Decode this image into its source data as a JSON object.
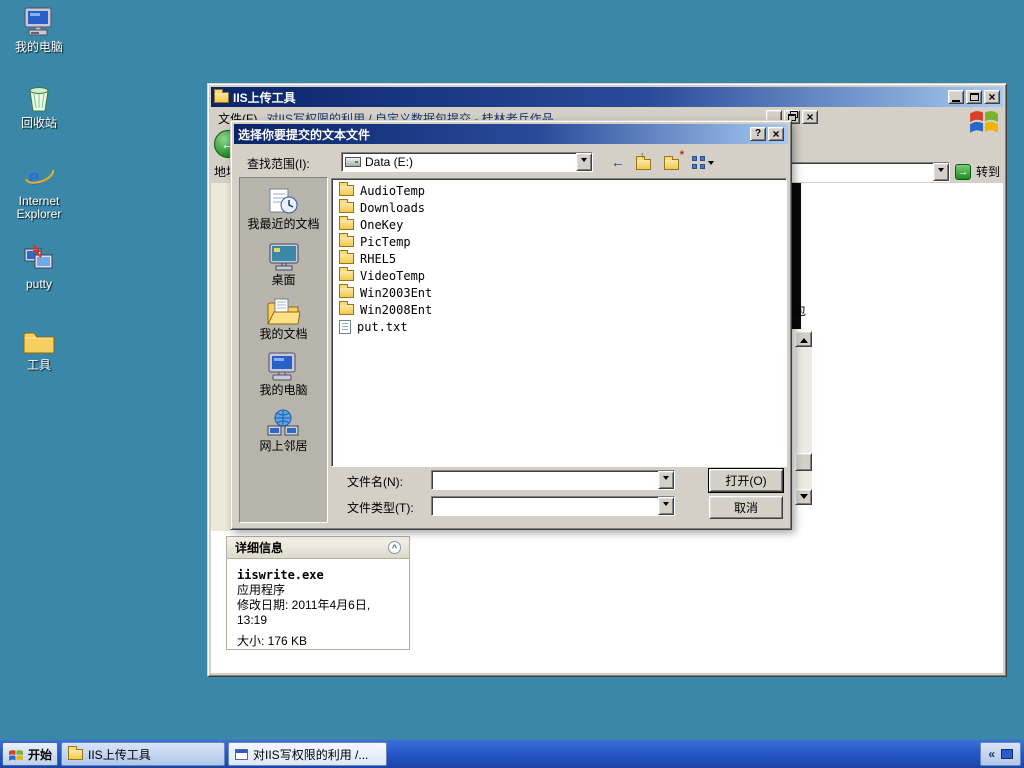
{
  "desktop": {
    "icons": [
      {
        "label": "我的电脑"
      },
      {
        "label": "回收站"
      },
      {
        "label": "Internet Explorer"
      },
      {
        "label": "putty"
      },
      {
        "label": "工具"
      }
    ]
  },
  "window": {
    "title": "IIS上传工具",
    "menu_file": "文件(F)",
    "child_title": "对IIS写权限的利用 / 自定义数据包提交 - 桂林老兵作品",
    "address_label": "地址",
    "address_value": "",
    "go_label": "转到",
    "clipped_text": "包",
    "details": {
      "header": "详细信息",
      "name": "iiswrite.exe",
      "type": "应用程序",
      "modified_line1": "修改日期: 2011年4月6日,",
      "modified_line2": "13:19",
      "size": "大小: 176 KB"
    }
  },
  "dialog": {
    "title": "选择你要提交的文本文件",
    "look_in": {
      "label": "查找范围(I):",
      "value": "Data (E:)"
    },
    "places": [
      {
        "label": "我最近的文档"
      },
      {
        "label": "桌面"
      },
      {
        "label": "我的文档"
      },
      {
        "label": "我的电脑"
      },
      {
        "label": "网上邻居"
      }
    ],
    "files": [
      {
        "name": "AudioTemp",
        "kind": "folder"
      },
      {
        "name": "Downloads",
        "kind": "folder"
      },
      {
        "name": "OneKey",
        "kind": "folder"
      },
      {
        "name": "PicTemp",
        "kind": "folder"
      },
      {
        "name": "RHEL5",
        "kind": "folder"
      },
      {
        "name": "VideoTemp",
        "kind": "folder"
      },
      {
        "name": "Win2003Ent",
        "kind": "folder"
      },
      {
        "name": "Win2008Ent",
        "kind": "folder"
      },
      {
        "name": "put.txt",
        "kind": "text"
      }
    ],
    "file_name": {
      "label": "文件名(N):",
      "value": ""
    },
    "file_type": {
      "label": "文件类型(T):",
      "value": ""
    },
    "buttons": {
      "open": "打开(O)",
      "cancel": "取消"
    }
  },
  "taskbar": {
    "start_label": "开始",
    "tasks": [
      {
        "label": "IIS上传工具"
      },
      {
        "label": "对IIS写权限的利用 /..."
      }
    ]
  },
  "colors": {
    "desktop": "#3a87a8",
    "title_dark": "#0a246a",
    "title_light": "#a6caf0",
    "chrome": "#d4d0c8",
    "taskbar": "#2456c8"
  }
}
